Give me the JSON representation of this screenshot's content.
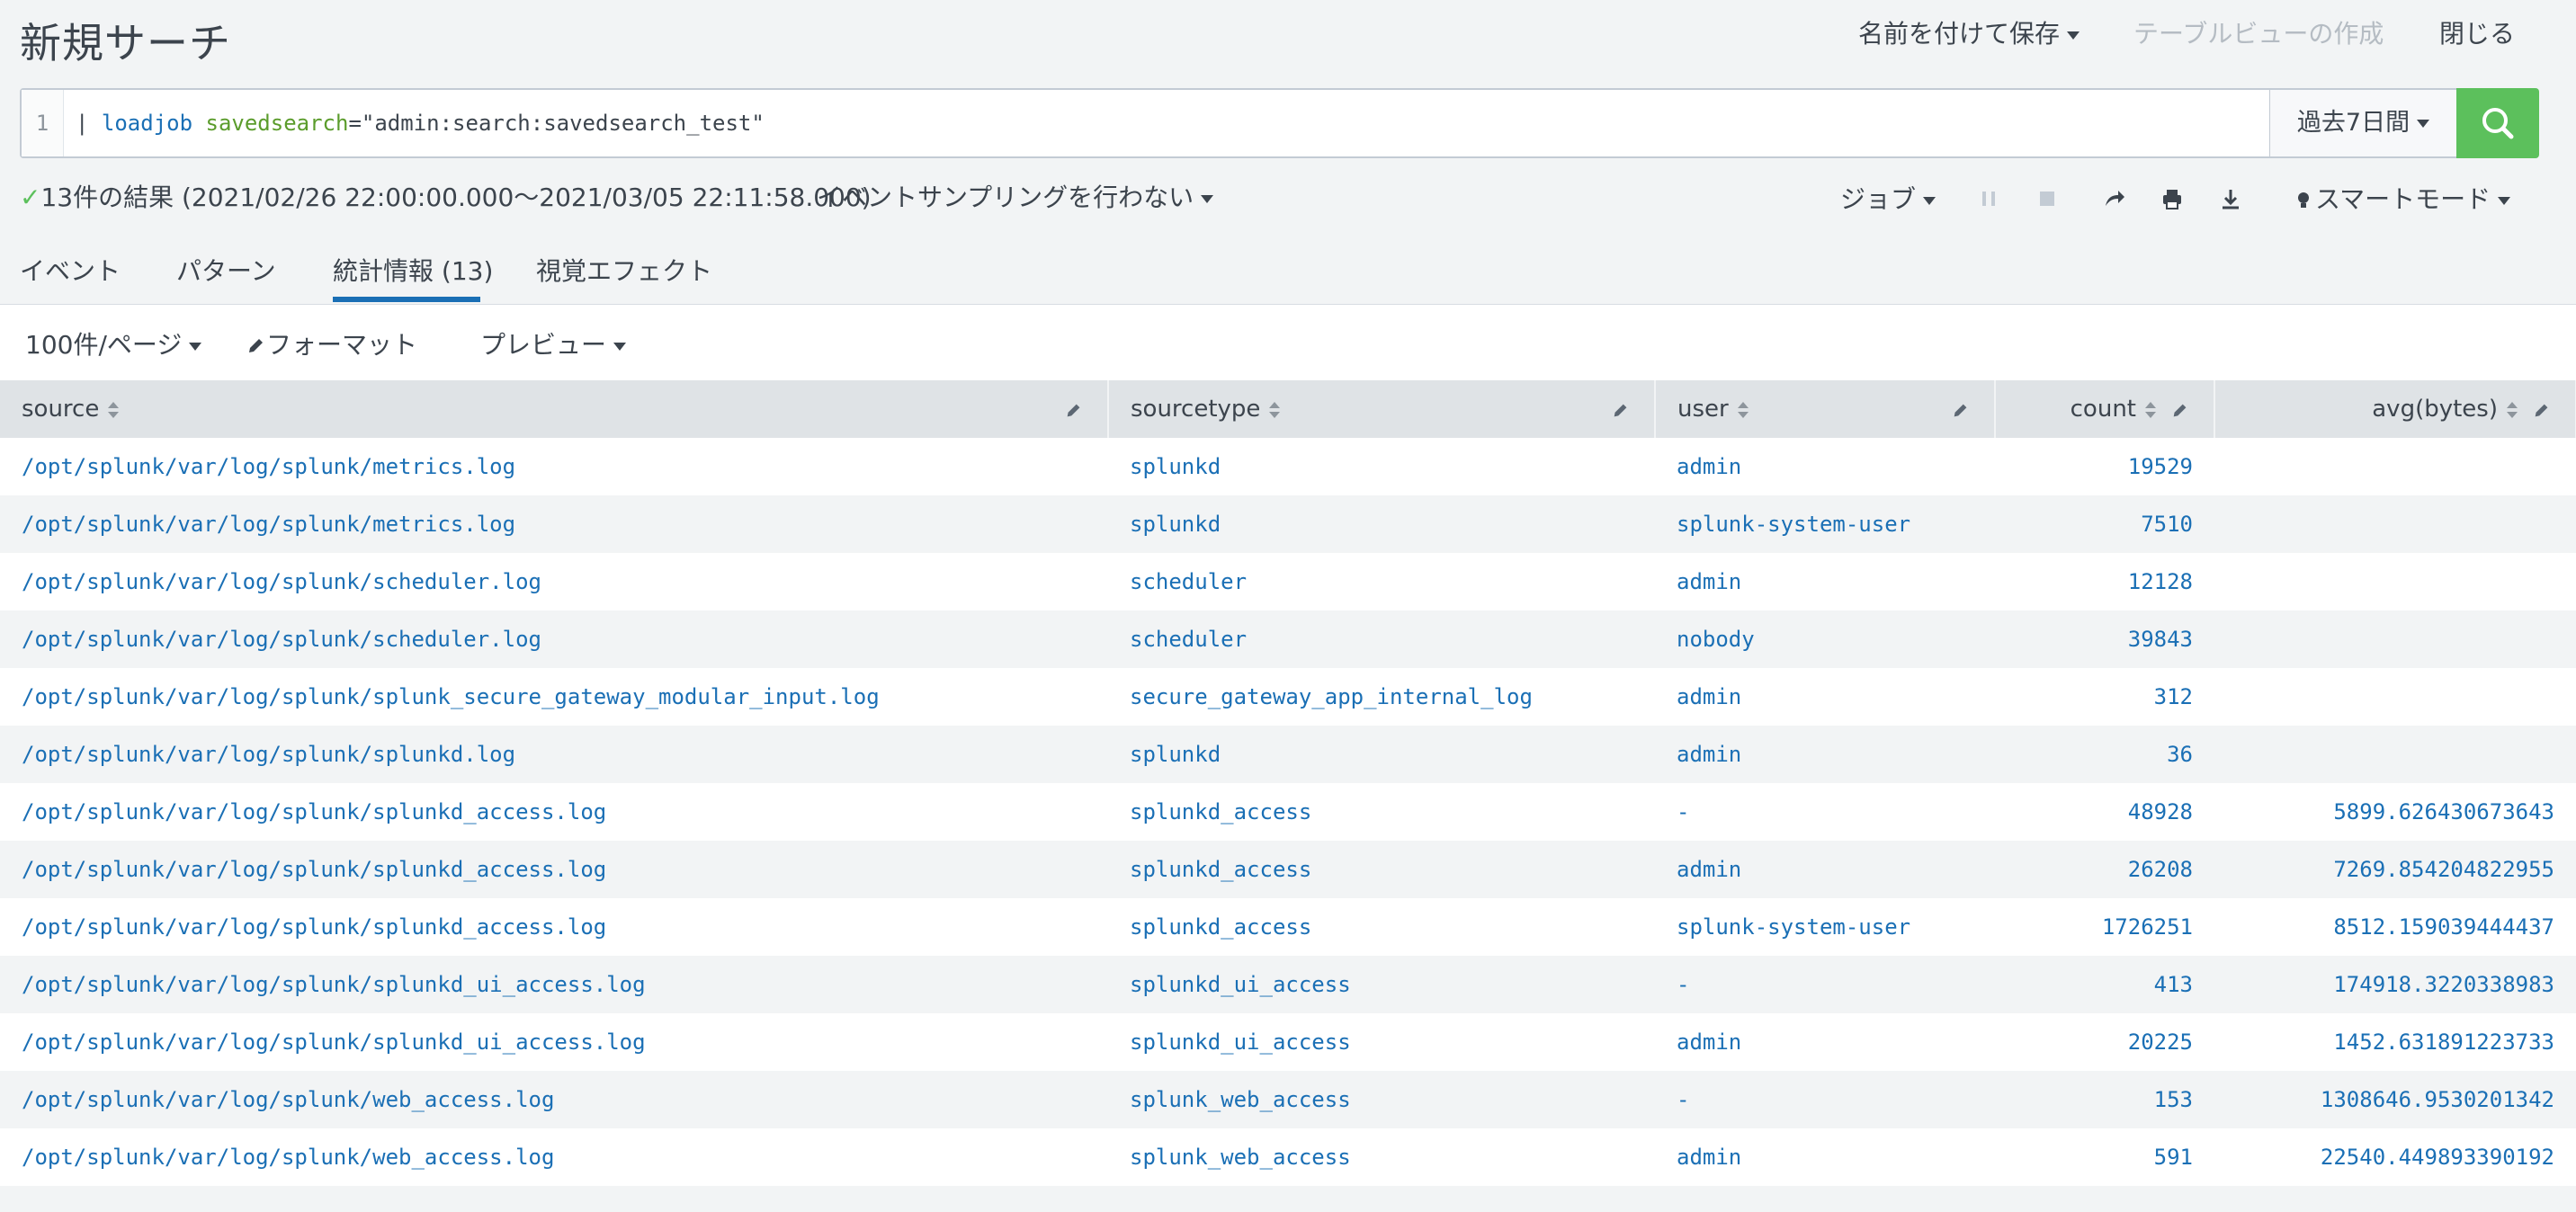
{
  "header": {
    "title": "新規サーチ",
    "save_as": "名前を付けて保存",
    "create_table_view": "テーブルビューの作成",
    "close": "閉じる"
  },
  "search": {
    "line_number": "1",
    "pipe": "| ",
    "command": "loadjob",
    "arg_name": " savedsearch",
    "arg_value": "=\"admin:search:savedsearch_test\"",
    "time_range": "過去7日間",
    "search_icon": "search-icon"
  },
  "results": {
    "summary": "13件の結果 (2021/02/26 22:00:00.000〜2021/03/05 22:11:58.000)",
    "sampling": "イベントサンプリングを行わない",
    "job": "ジョブ",
    "mode": "スマートモード"
  },
  "tabs": {
    "events": "イベント",
    "patterns": "パターン",
    "statistics": "統計情報",
    "statistics_count": "(13)",
    "visualization": "視覚エフェクト"
  },
  "toolbar": {
    "per_page": "100件/ページ",
    "format": "フォーマット",
    "preview": "プレビュー"
  },
  "table": {
    "columns": [
      "source",
      "sourcetype",
      "user",
      "count",
      "avg(bytes)"
    ],
    "rows": [
      [
        "/opt/splunk/var/log/splunk/metrics.log",
        "splunkd",
        "admin",
        "19529",
        ""
      ],
      [
        "/opt/splunk/var/log/splunk/metrics.log",
        "splunkd",
        "splunk-system-user",
        "7510",
        ""
      ],
      [
        "/opt/splunk/var/log/splunk/scheduler.log",
        "scheduler",
        "admin",
        "12128",
        ""
      ],
      [
        "/opt/splunk/var/log/splunk/scheduler.log",
        "scheduler",
        "nobody",
        "39843",
        ""
      ],
      [
        "/opt/splunk/var/log/splunk/splunk_secure_gateway_modular_input.log",
        "secure_gateway_app_internal_log",
        "admin",
        "312",
        ""
      ],
      [
        "/opt/splunk/var/log/splunk/splunkd.log",
        "splunkd",
        "admin",
        "36",
        ""
      ],
      [
        "/opt/splunk/var/log/splunk/splunkd_access.log",
        "splunkd_access",
        "-",
        "48928",
        "5899.626430673643"
      ],
      [
        "/opt/splunk/var/log/splunk/splunkd_access.log",
        "splunkd_access",
        "admin",
        "26208",
        "7269.854204822955"
      ],
      [
        "/opt/splunk/var/log/splunk/splunkd_access.log",
        "splunkd_access",
        "splunk-system-user",
        "1726251",
        "8512.159039444437"
      ],
      [
        "/opt/splunk/var/log/splunk/splunkd_ui_access.log",
        "splunkd_ui_access",
        "-",
        "413",
        "174918.3220338983"
      ],
      [
        "/opt/splunk/var/log/splunk/splunkd_ui_access.log",
        "splunkd_ui_access",
        "admin",
        "20225",
        "1452.631891223733"
      ],
      [
        "/opt/splunk/var/log/splunk/web_access.log",
        "splunk_web_access",
        "-",
        "153",
        "1308646.9530201342"
      ],
      [
        "/opt/splunk/var/log/splunk/web_access.log",
        "splunk_web_access",
        "admin",
        "591",
        "22540.449893390192"
      ]
    ]
  },
  "colors": {
    "accent": "#1a6fb5",
    "search_button": "#5cc05c",
    "header_bg": "#dfe3e6"
  }
}
